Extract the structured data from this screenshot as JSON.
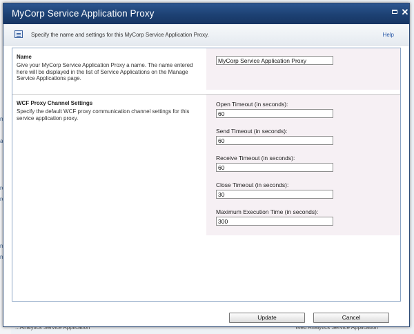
{
  "background": {
    "left_fragments": [
      "ne",
      "ag",
      "rc",
      "rc",
      "n",
      "n"
    ],
    "bottom_left": "...Analytics Service Application",
    "bottom_right": "Web Analytics Service Application"
  },
  "dialog": {
    "title": "MyCorp Service Application Proxy",
    "restore_icon": "restore-icon",
    "close_icon": "close-icon",
    "close_glyph": "✕"
  },
  "infobar": {
    "text": "Specify the name and settings for this MyCorp Service Application Proxy.",
    "help": "Help"
  },
  "sections": {
    "name": {
      "title": "Name",
      "description": "Give your MyCorp Service Application Proxy a name. The name entered here will be displayed in the list of Service Applications on the Manage Service Applications page.",
      "input_value": "MyCorp Service Application Proxy"
    },
    "wcf": {
      "title": "WCF Proxy Channel Settings",
      "description": "Specify the default WCF proxy communication channel settings for this service application proxy.",
      "fields": [
        {
          "label": "Open Timeout (in seconds):",
          "value": "60"
        },
        {
          "label": "Send Timeout (in seconds):",
          "value": "60"
        },
        {
          "label": "Receive Timeout (in seconds):",
          "value": "60"
        },
        {
          "label": "Close Timeout (in seconds):",
          "value": "30"
        },
        {
          "label": "Maximum Execution Time (in seconds):",
          "value": "300"
        }
      ]
    }
  },
  "buttons": {
    "update": "Update",
    "cancel": "Cancel"
  }
}
